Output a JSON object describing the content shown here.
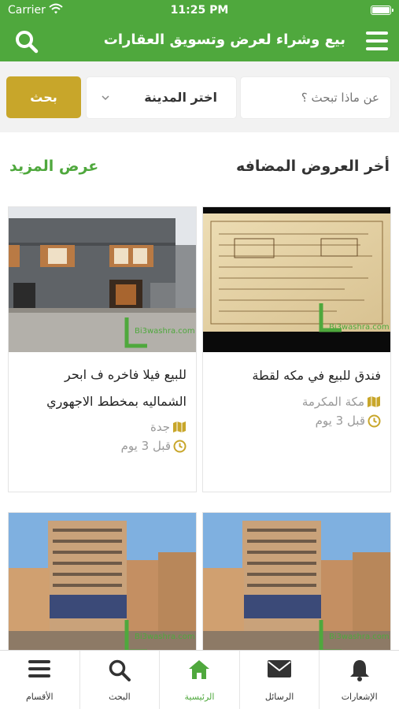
{
  "status_bar": {
    "carrier": "Carrier",
    "time": "11:25 PM"
  },
  "header": {
    "title": "بيع وشراء لعرض وتسويق العقارات",
    "search_icon": "search-icon",
    "menu_icon": "menu-icon"
  },
  "search": {
    "placeholder": "عن ماذا تبحث ؟",
    "city_label": "اختر المدينة",
    "button_label": "بحث"
  },
  "section": {
    "title": "أخر العروض المضافه",
    "show_more": "عرض المزيد"
  },
  "listings": [
    {
      "title": "فندق للبيع في مكه لقطة",
      "city": "مكة المكرمة",
      "age": "قبل 3 يوم"
    },
    {
      "title_line1": "للبيع فيلا فاخره ف ابحر",
      "title_line2": "الشماليه بمخطط الاجهوري",
      "city": "جدة",
      "age": "قبل 3 يوم"
    },
    {
      "title": ""
    },
    {
      "title": ""
    }
  ],
  "tabs": [
    {
      "label": "الأقسام",
      "icon": "menu-icon"
    },
    {
      "label": "البحث",
      "icon": "search-icon"
    },
    {
      "label": "الرئيسية",
      "icon": "home-icon",
      "active": true
    },
    {
      "label": "الرسائل",
      "icon": "envelope-icon"
    },
    {
      "label": "الإشعارات",
      "icon": "bell-icon"
    }
  ],
  "colors": {
    "primary_green": "#4fa83d",
    "gold": "#c8a62a"
  }
}
